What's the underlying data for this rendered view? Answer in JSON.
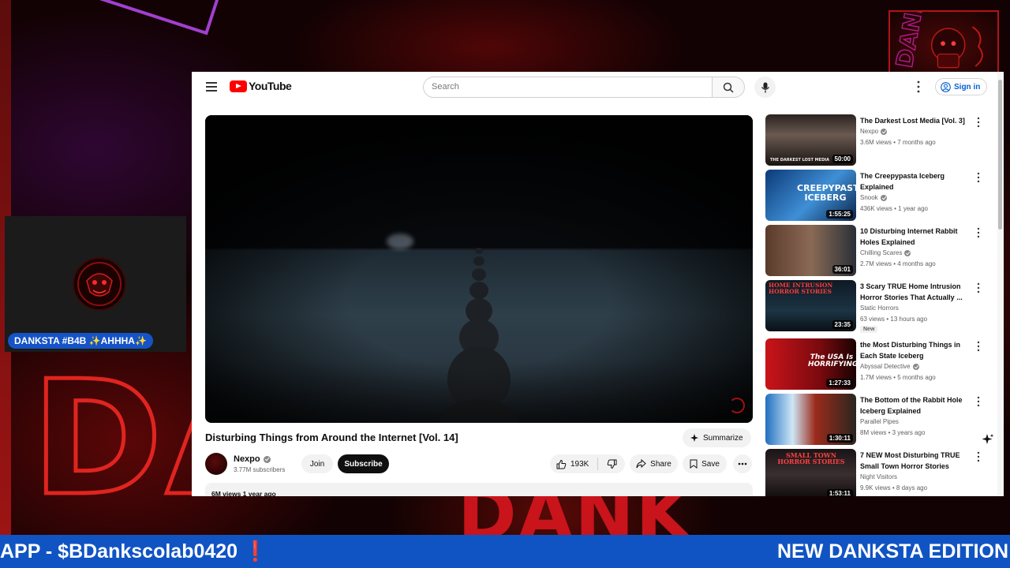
{
  "stream": {
    "cam_badge": "DANKSTA #B4B ✨AHHHA✨",
    "ticker_left": "APP - $BDankscolab0420 ❗",
    "ticker_right": "NEW DANKSTA EDITION",
    "background_word": "DANK",
    "colors": {
      "ticker": "#1054c4",
      "accent_red": "#e0241f",
      "accent_purple": "#a23fd0"
    }
  },
  "youtube": {
    "logo_text": "YouTube",
    "search_placeholder": "Search",
    "sign_in": "Sign in",
    "video": {
      "title": "Disturbing Things from Around the Internet [Vol. 14]",
      "summarize": "Summarize",
      "channel": "Nexpo",
      "subscribers": "3.77M subscribers",
      "join": "Join",
      "subscribe": "Subscribe",
      "likes": "193K",
      "share": "Share",
      "save": "Save",
      "views_date": "6M views  1 year ago"
    },
    "related": [
      {
        "title": "The Darkest Lost Media [Vol. 3]",
        "channel": "Nexpo",
        "verified": true,
        "meta": "3.6M views • 7 months ago",
        "duration": "50:00",
        "thumb_text": "THE DARKEST LOST MEDIA",
        "new": ""
      },
      {
        "title": "The Creepypasta Iceberg Explained",
        "channel": "Snook",
        "verified": true,
        "meta": "436K views • 1 year ago",
        "duration": "1:55:25",
        "thumb_text": "CREEPYPASTA ICEBERG",
        "new": ""
      },
      {
        "title": "10 Disturbing Internet Rabbit Holes Explained",
        "channel": "Chilling Scares",
        "verified": true,
        "meta": "2.7M views • 4 months ago",
        "duration": "36:01",
        "thumb_text": "",
        "new": ""
      },
      {
        "title": "3 Scary TRUE Home Intrusion Horror Stories That Actually ...",
        "channel": "Static Horrors",
        "verified": false,
        "meta": "63 views • 13 hours ago",
        "duration": "23:35",
        "thumb_text": "HOME INTRUSION HORROR STORIES",
        "new": "New"
      },
      {
        "title": "the Most Disturbing Things in Each State Iceberg",
        "channel": "Abyssal Detective",
        "verified": true,
        "meta": "1.7M views • 5 months ago",
        "duration": "1:27:33",
        "thumb_text": "The USA Is HORRIFYING",
        "new": ""
      },
      {
        "title": "The Bottom of the Rabbit Hole Iceberg Explained",
        "channel": "Parallel Pipes",
        "verified": false,
        "meta": "8M views • 3 years ago",
        "duration": "1:30:11",
        "thumb_text": "",
        "new": ""
      },
      {
        "title": "7 NEW Most Disturbing TRUE Small Town Horror Stories",
        "channel": "Night Visitors",
        "verified": false,
        "meta": "9.9K views • 8 days ago",
        "duration": "1:53:11",
        "thumb_text": "SMALL TOWN HORROR STORIES",
        "new": ""
      }
    ]
  }
}
